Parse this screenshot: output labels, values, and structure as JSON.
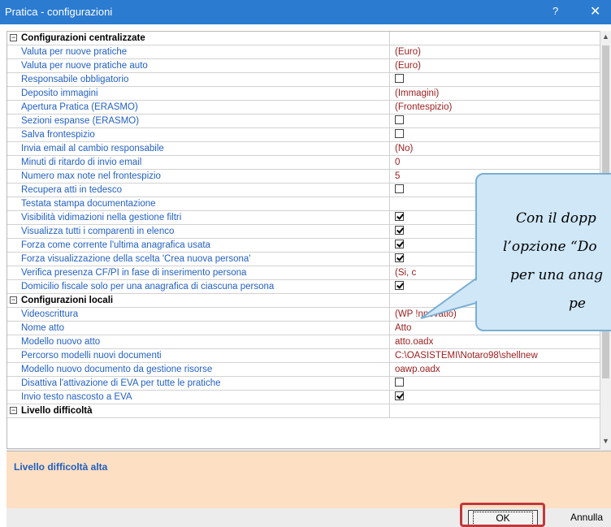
{
  "window": {
    "title": "Pratica - configurazioni",
    "help": "?",
    "close": "✕"
  },
  "sections": [
    {
      "label": "Configurazioni centralizzate",
      "rows": [
        {
          "label": "Valuta per nuove pratiche",
          "value": "(Euro)"
        },
        {
          "label": "Valuta per nuove pratiche auto",
          "value": "(Euro)"
        },
        {
          "label": "Responsabile obbligatorio",
          "check": false
        },
        {
          "label": "Deposito immagini",
          "value": "(Immagini)"
        },
        {
          "label": "Apertura Pratica (ERASMO)",
          "value": "(Frontespizio)"
        },
        {
          "label": "Sezioni espanse (ERASMO)",
          "check": false
        },
        {
          "label": "Salva frontespizio",
          "check": false
        },
        {
          "label": "Invia email al cambio responsabile",
          "value": "(No)"
        },
        {
          "label": "Minuti di ritardo di invio email",
          "value": "0"
        },
        {
          "label": "Numero max note nel frontespizio",
          "value": "5"
        },
        {
          "label": "Recupera atti in tedesco",
          "check": false
        },
        {
          "label": "Testata stampa documentazione",
          "value": ""
        },
        {
          "label": "Visibilità vidimazioni nella gestione filtri",
          "check": true
        },
        {
          "label": "Visualizza tutti i comparenti in elenco",
          "check": true
        },
        {
          "label": "Forza come corrente l'ultima anagrafica usata",
          "check": true
        },
        {
          "label": "Forza visualizzazione della scelta 'Crea nuova persona'",
          "check": true
        },
        {
          "label": "Verifica presenza CF/PI in fase di inserimento persona",
          "value": "(Si, c"
        },
        {
          "label": "Domicilio fiscale solo per una anagrafica di ciascuna persona",
          "check": true
        }
      ]
    },
    {
      "label": "Configurazioni locali",
      "rows": [
        {
          "label": "Videoscrittura",
          "value": "(WP !nnovatio)"
        },
        {
          "label": "Nome atto",
          "value": "Atto"
        },
        {
          "label": "Modello nuovo atto",
          "value": "atto.oadx"
        },
        {
          "label": "Percorso modelli nuovi documenti",
          "value": "C:\\OASISTEMI\\Notaro98\\shellnew"
        },
        {
          "label": "Modello nuovo documento da gestione risorse",
          "value": "oawp.oadx"
        },
        {
          "label": "Disattiva l'attivazione di EVA per tutte le pratiche",
          "check": false
        },
        {
          "label": "Invio testo nascosto a EVA",
          "check": true
        }
      ]
    },
    {
      "label": "Livello difficoltà",
      "rows": []
    }
  ],
  "description": "Livello difficoltà alta",
  "buttons": {
    "ok": "OK",
    "cancel": "Annulla"
  },
  "callout": {
    "line1": "Con il dopp",
    "line2": "l’opzione “Do",
    "line3": "per una anag",
    "line4": "pe"
  }
}
